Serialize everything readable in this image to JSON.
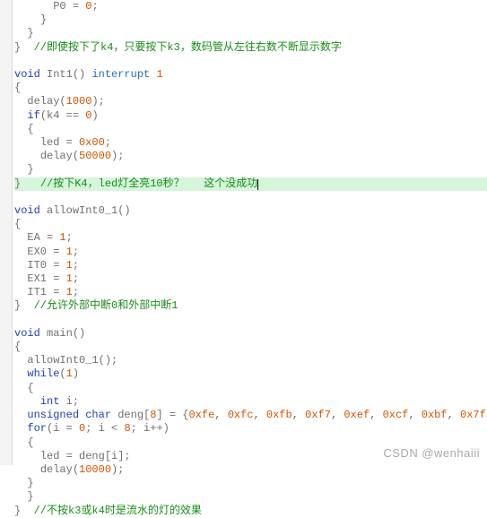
{
  "watermark": "CSDN @wenhaiii",
  "lines": [
    {
      "indent": "      ",
      "tokens": [
        {
          "t": "id",
          "v": "P0 = "
        },
        {
          "t": "num",
          "v": "0"
        },
        {
          "t": "id",
          "v": ";"
        }
      ]
    },
    {
      "indent": "    ",
      "tokens": [
        {
          "t": "id",
          "v": "}"
        }
      ]
    },
    {
      "indent": "  ",
      "tokens": [
        {
          "t": "id",
          "v": "}"
        }
      ]
    },
    {
      "indent": "",
      "tokens": [
        {
          "t": "id",
          "v": "}  "
        },
        {
          "t": "cmt",
          "v": "//即使按下了k4，只要按下k3，数码管从左往右数不断显示数字"
        }
      ]
    },
    {
      "blank": true
    },
    {
      "indent": "",
      "tokens": [
        {
          "t": "kw",
          "v": "void"
        },
        {
          "t": "id",
          "v": " Int1() "
        },
        {
          "t": "kw2",
          "v": "interrupt"
        },
        {
          "t": "id",
          "v": " "
        },
        {
          "t": "num",
          "v": "1"
        }
      ]
    },
    {
      "indent": "",
      "tokens": [
        {
          "t": "id",
          "v": "{"
        }
      ]
    },
    {
      "indent": "  ",
      "tokens": [
        {
          "t": "id",
          "v": "delay("
        },
        {
          "t": "num",
          "v": "1000"
        },
        {
          "t": "id",
          "v": ");"
        }
      ]
    },
    {
      "indent": "  ",
      "tokens": [
        {
          "t": "kw",
          "v": "if"
        },
        {
          "t": "id",
          "v": "(k4 == "
        },
        {
          "t": "num",
          "v": "0"
        },
        {
          "t": "id",
          "v": ")"
        }
      ]
    },
    {
      "indent": "  ",
      "tokens": [
        {
          "t": "id",
          "v": "{"
        }
      ]
    },
    {
      "indent": "    ",
      "tokens": [
        {
          "t": "id",
          "v": "led = "
        },
        {
          "t": "num",
          "v": "0x00"
        },
        {
          "t": "id",
          "v": ";"
        }
      ]
    },
    {
      "indent": "    ",
      "tokens": [
        {
          "t": "id",
          "v": "delay("
        },
        {
          "t": "num",
          "v": "50000"
        },
        {
          "t": "id",
          "v": ");"
        }
      ]
    },
    {
      "indent": "  ",
      "tokens": [
        {
          "t": "id",
          "v": "}"
        }
      ]
    },
    {
      "hl": true,
      "indent": "",
      "tokens": [
        {
          "t": "id",
          "v": "}   "
        },
        {
          "t": "cmt",
          "v": "//按下K4，led灯全亮10秒？   这个没成功"
        }
      ],
      "caret": true
    },
    {
      "blank": true
    },
    {
      "indent": "",
      "tokens": [
        {
          "t": "kw",
          "v": "void"
        },
        {
          "t": "id",
          "v": " allowInt0_1()"
        }
      ]
    },
    {
      "indent": "",
      "tokens": [
        {
          "t": "id",
          "v": "{"
        }
      ]
    },
    {
      "indent": "  ",
      "tokens": [
        {
          "t": "id",
          "v": "EA = "
        },
        {
          "t": "num",
          "v": "1"
        },
        {
          "t": "id",
          "v": ";"
        }
      ]
    },
    {
      "indent": "  ",
      "tokens": [
        {
          "t": "id",
          "v": "EX0 = "
        },
        {
          "t": "num",
          "v": "1"
        },
        {
          "t": "id",
          "v": ";"
        }
      ]
    },
    {
      "indent": "  ",
      "tokens": [
        {
          "t": "id",
          "v": "IT0 = "
        },
        {
          "t": "num",
          "v": "1"
        },
        {
          "t": "id",
          "v": ";"
        }
      ]
    },
    {
      "indent": "  ",
      "tokens": [
        {
          "t": "id",
          "v": "EX1 = "
        },
        {
          "t": "num",
          "v": "1"
        },
        {
          "t": "id",
          "v": ";"
        }
      ]
    },
    {
      "indent": "  ",
      "tokens": [
        {
          "t": "id",
          "v": "IT1 = "
        },
        {
          "t": "num",
          "v": "1"
        },
        {
          "t": "id",
          "v": ";"
        }
      ]
    },
    {
      "indent": "",
      "tokens": [
        {
          "t": "id",
          "v": "}  "
        },
        {
          "t": "cmt",
          "v": "//允许外部中断0和外部中断1"
        }
      ]
    },
    {
      "blank": true
    },
    {
      "indent": "",
      "tokens": [
        {
          "t": "kw",
          "v": "void"
        },
        {
          "t": "id",
          "v": " main()"
        }
      ]
    },
    {
      "indent": "",
      "tokens": [
        {
          "t": "id",
          "v": "{"
        }
      ]
    },
    {
      "indent": "  ",
      "tokens": [
        {
          "t": "id",
          "v": "allowInt0_1();"
        }
      ]
    },
    {
      "indent": "  ",
      "tokens": [
        {
          "t": "kw",
          "v": "while"
        },
        {
          "t": "id",
          "v": "("
        },
        {
          "t": "num",
          "v": "1"
        },
        {
          "t": "id",
          "v": ")"
        }
      ]
    },
    {
      "indent": "  ",
      "tokens": [
        {
          "t": "id",
          "v": "{"
        }
      ]
    },
    {
      "indent": "    ",
      "tokens": [
        {
          "t": "kw",
          "v": "int"
        },
        {
          "t": "id",
          "v": " i;"
        }
      ]
    },
    {
      "indent": "  ",
      "tokens": [
        {
          "t": "kw",
          "v": "unsigned"
        },
        {
          "t": "id",
          "v": " "
        },
        {
          "t": "kw",
          "v": "char"
        },
        {
          "t": "id",
          "v": " deng["
        },
        {
          "t": "num",
          "v": "8"
        },
        {
          "t": "id",
          "v": "] = {"
        },
        {
          "t": "num",
          "v": "0xfe"
        },
        {
          "t": "id",
          "v": ", "
        },
        {
          "t": "num",
          "v": "0xfc"
        },
        {
          "t": "id",
          "v": ", "
        },
        {
          "t": "num",
          "v": "0xfb"
        },
        {
          "t": "id",
          "v": ", "
        },
        {
          "t": "num",
          "v": "0xf7"
        },
        {
          "t": "id",
          "v": ", "
        },
        {
          "t": "num",
          "v": "0xef"
        },
        {
          "t": "id",
          "v": ", "
        },
        {
          "t": "num",
          "v": "0xcf"
        },
        {
          "t": "id",
          "v": ", "
        },
        {
          "t": "num",
          "v": "0xbf"
        },
        {
          "t": "id",
          "v": ", "
        },
        {
          "t": "num",
          "v": "0x7f"
        },
        {
          "t": "id",
          "v": "};"
        }
      ]
    },
    {
      "indent": "  ",
      "tokens": [
        {
          "t": "kw",
          "v": "for"
        },
        {
          "t": "id",
          "v": "(i = "
        },
        {
          "t": "num",
          "v": "0"
        },
        {
          "t": "id",
          "v": "; i < "
        },
        {
          "t": "num",
          "v": "8"
        },
        {
          "t": "id",
          "v": "; i++)"
        }
      ]
    },
    {
      "indent": "  ",
      "tokens": [
        {
          "t": "id",
          "v": "{"
        }
      ]
    },
    {
      "indent": "    ",
      "tokens": [
        {
          "t": "id",
          "v": "led = deng[i];"
        }
      ]
    },
    {
      "indent": "    ",
      "tokens": [
        {
          "t": "id",
          "v": "delay("
        },
        {
          "t": "num",
          "v": "10000"
        },
        {
          "t": "id",
          "v": ");"
        }
      ]
    },
    {
      "indent": "  ",
      "tokens": [
        {
          "t": "id",
          "v": "}"
        }
      ]
    },
    {
      "indent": "  ",
      "tokens": [
        {
          "t": "id",
          "v": "}"
        }
      ]
    },
    {
      "indent": "",
      "tokens": [
        {
          "t": "id",
          "v": "}  "
        },
        {
          "t": "cmt",
          "v": "//不按k3或k4时是流水的灯的效果"
        }
      ]
    }
  ]
}
